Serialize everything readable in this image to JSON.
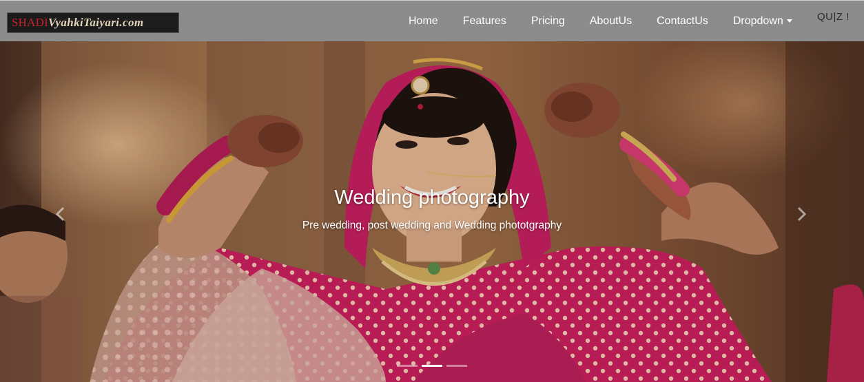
{
  "brand": {
    "part1": "SHADI",
    "part2": "VyahkiTaiyari.com"
  },
  "nav": {
    "items": [
      {
        "label": "Home"
      },
      {
        "label": "Features"
      },
      {
        "label": "Pricing"
      },
      {
        "label": "AboutUs"
      },
      {
        "label": "ContactUs"
      },
      {
        "label": "Dropdown",
        "has_caret": true
      }
    ],
    "quiz_label": "QU|Z !"
  },
  "carousel": {
    "title": "Wedding photography",
    "subtitle": "Pre wedding, post wedding and Wedding phototgraphy",
    "indicators": [
      {
        "active": false
      },
      {
        "active": true
      },
      {
        "active": false
      }
    ],
    "prev_icon": "chevron-left-icon",
    "next_icon": "chevron-right-icon"
  },
  "colors": {
    "navbar_bg": "#8c8c8c",
    "brand_bg": "#1c1c1c",
    "brand_red": "#c8202a",
    "brand_cream": "#e2d5b8",
    "nav_text": "#ffffff",
    "bridal_red": "#c21d55"
  }
}
